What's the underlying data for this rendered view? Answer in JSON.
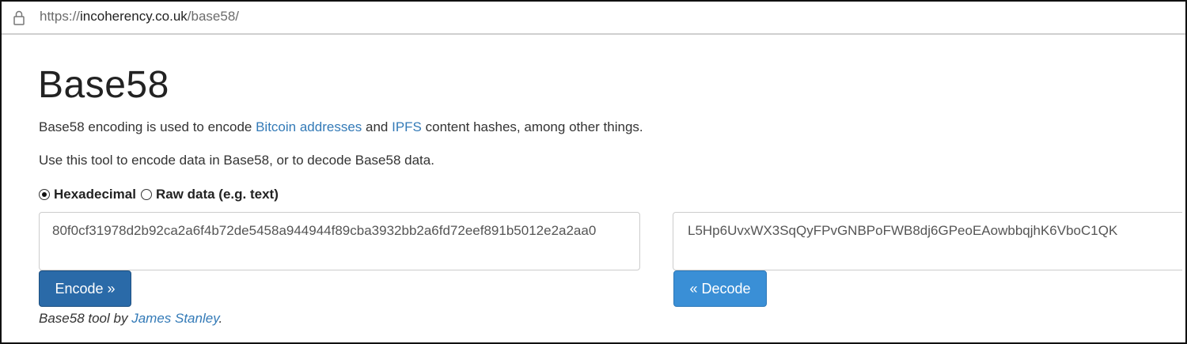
{
  "browser": {
    "url_prefix": "https://",
    "url_host": "incoherency.co.uk",
    "url_path": "/base58/"
  },
  "page": {
    "title": "Base58",
    "intro": {
      "before": "Base58 encoding is used to encode ",
      "link1": "Bitcoin addresses",
      "middle": " and ",
      "link2": "IPFS",
      "after": " content hashes, among other things."
    },
    "instructions": "Use this tool to encode data in Base58, or to decode Base58 data.",
    "format_options": {
      "hex_label": "Hexadecimal",
      "raw_label": "Raw data (e.g. text)",
      "selected": "Hexadecimal"
    },
    "hex_input_value": "80f0cf31978d2b92ca2a6f4b72de5458a944944f89cba3932bb2a6fd72eef891b5012e2a2aa0",
    "base58_value": "L5Hp6UvxWX3SqQyFPvGNBPoFWB8dj6GPeoEAowbbqjhK6VboC1QK",
    "encode_button": "Encode »",
    "decode_button": "« Decode",
    "footer": {
      "before": "Base58 tool by ",
      "author_link": "James Stanley",
      "after": "."
    }
  },
  "colors": {
    "link": "#337ab7",
    "encode_button": "#2a6aa8",
    "decode_button": "#3a8fd6"
  },
  "icons": {
    "urlbar": "lock-icon"
  }
}
